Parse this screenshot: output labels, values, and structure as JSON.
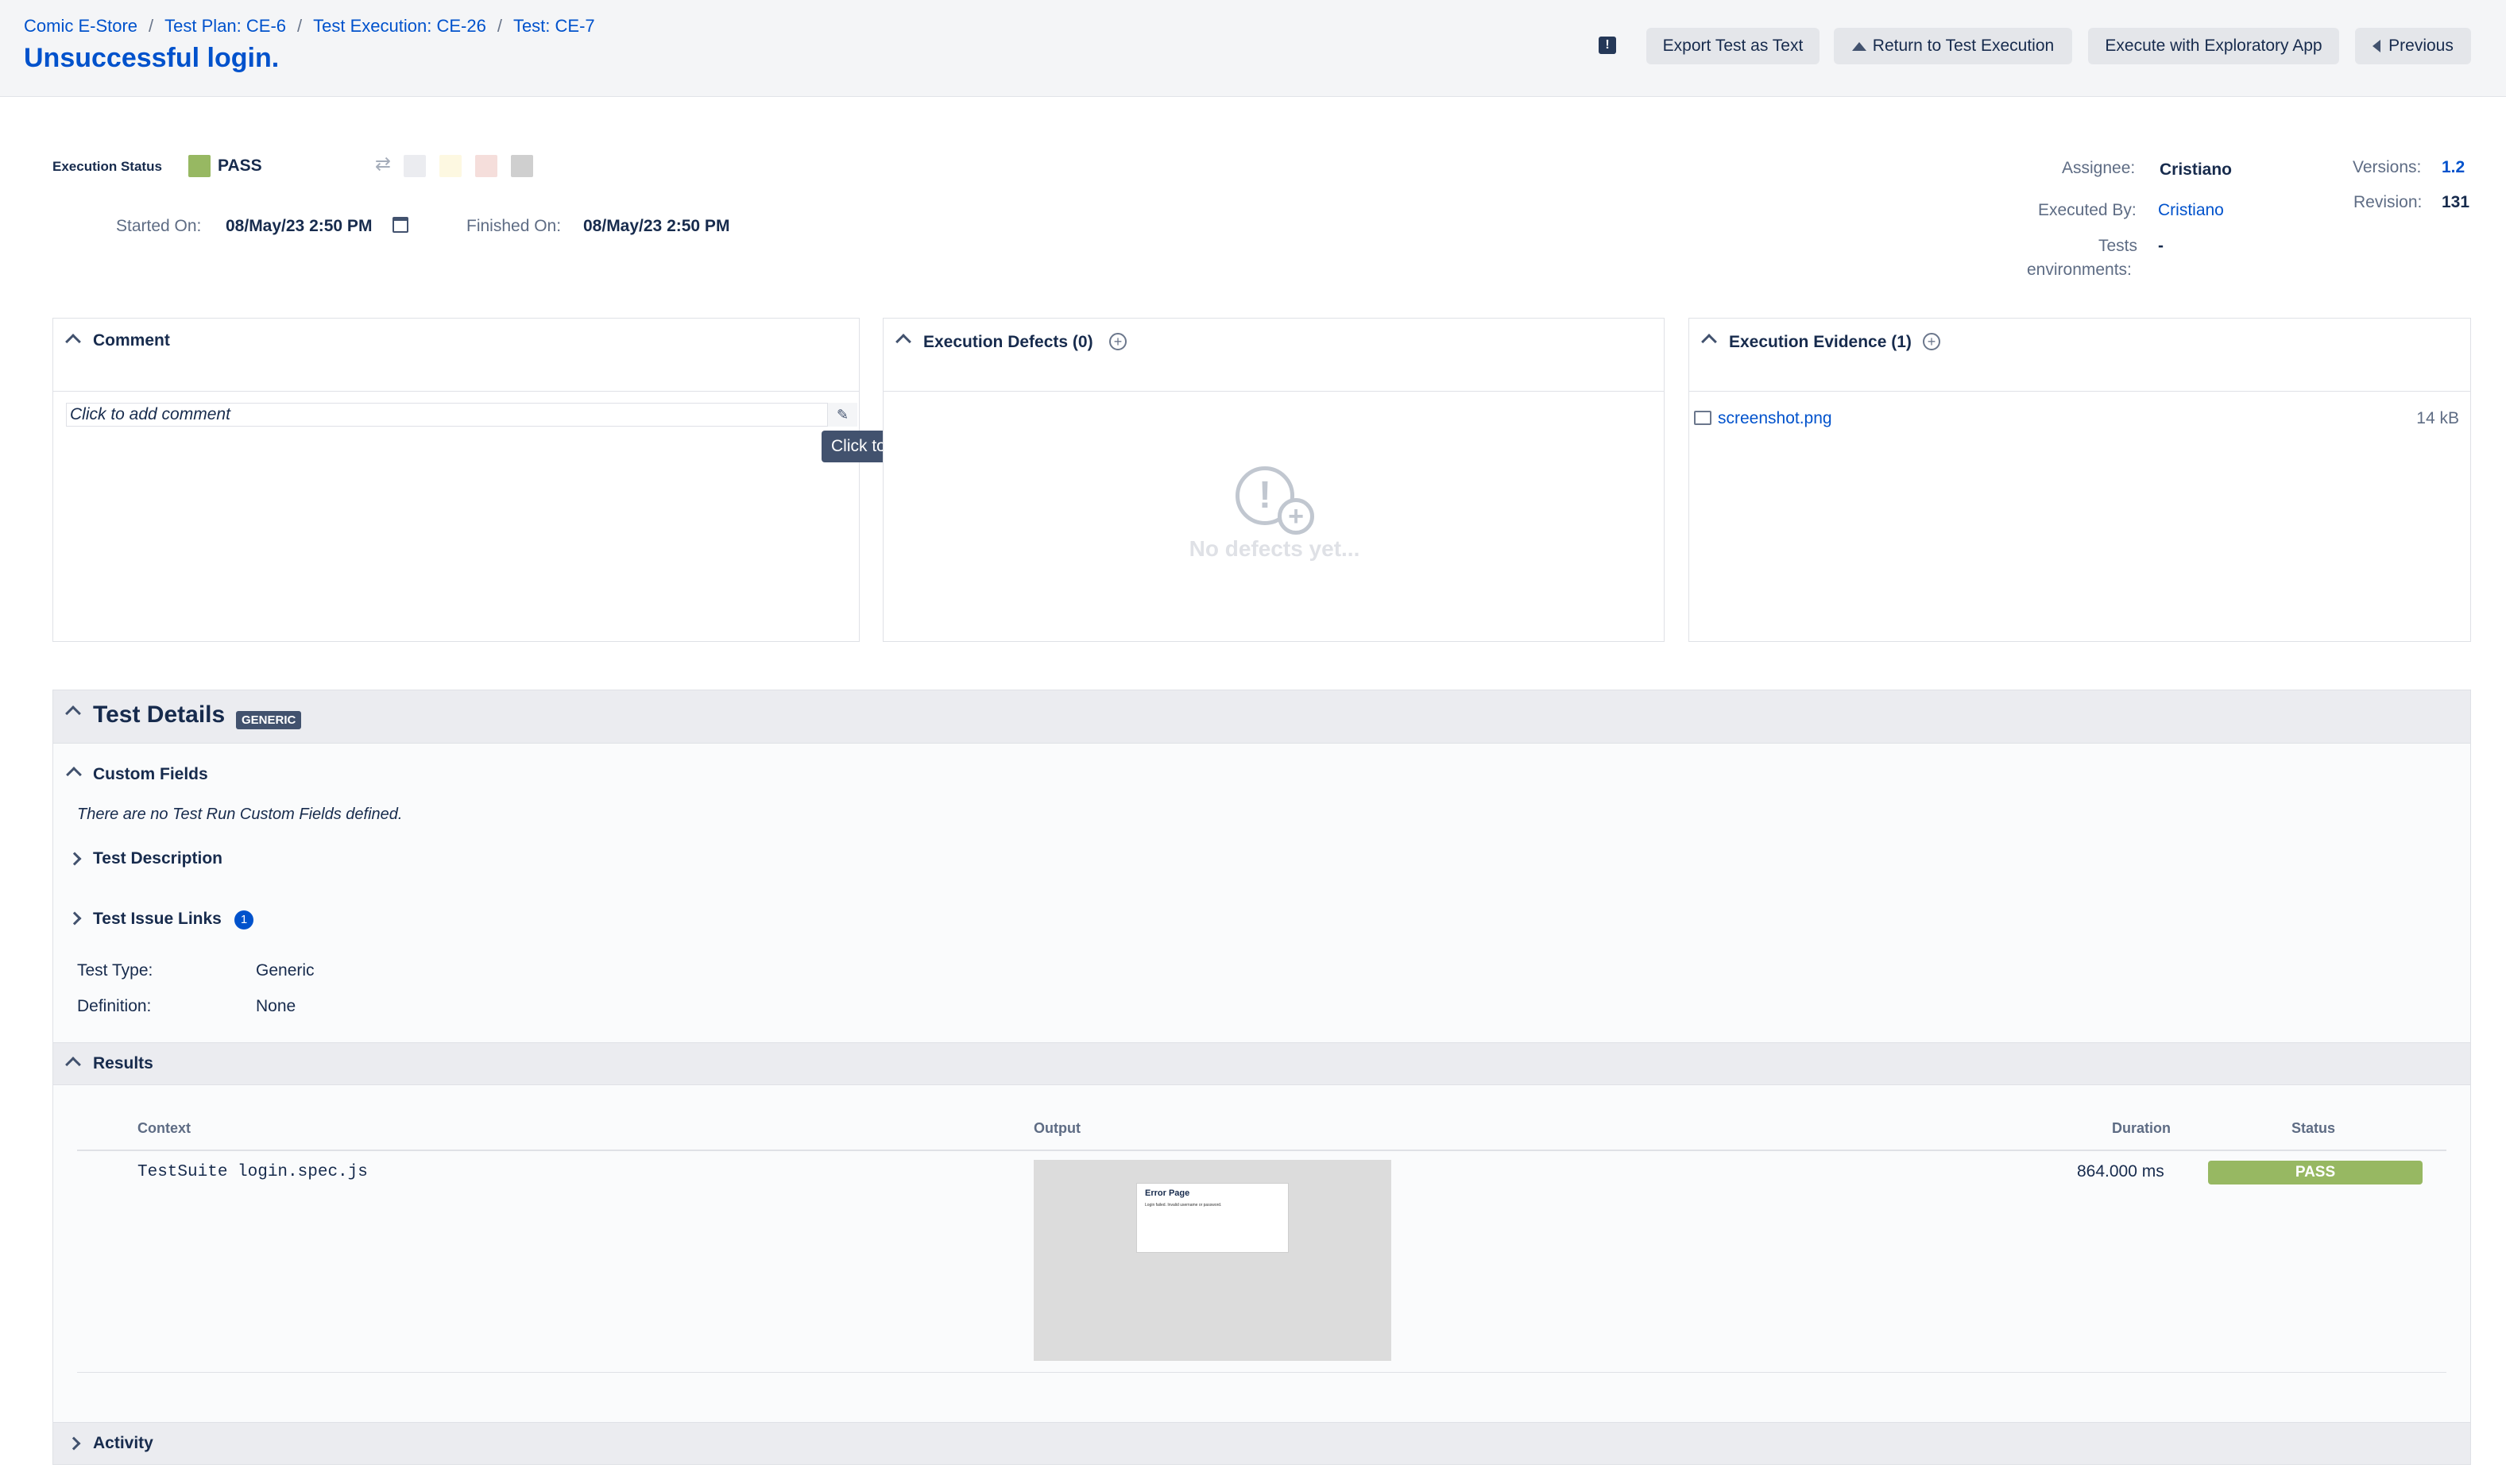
{
  "breadcrumb": {
    "project": "Comic E-Store",
    "test_plan": "Test Plan: CE-6",
    "test_execution": "Test Execution: CE-26",
    "test": "Test: CE-7"
  },
  "page_title": "Unsuccessful login.",
  "header_buttons": {
    "export": "Export Test as Text",
    "return": "Return to Test Execution",
    "exploratory": "Execute with Exploratory App",
    "previous": "Previous"
  },
  "status": {
    "label": "Execution Status",
    "value": "PASS",
    "pass_color": "#97b862",
    "swatches": [
      "#ebecf0",
      "#fdf8e1",
      "#f5dedb",
      "#cfcfcf"
    ]
  },
  "timing": {
    "started_label": "Started On:",
    "started_value": "08/May/23 2:50 PM",
    "finished_label": "Finished On:",
    "finished_value": "08/May/23 2:50 PM"
  },
  "meta": {
    "assignee_label": "Assignee:",
    "assignee_value": "Cristiano",
    "executed_label": "Executed By:",
    "executed_value": "Cristiano",
    "env_label_1": "Tests",
    "env_label_2": "environments:",
    "env_value": "-",
    "versions_label": "Versions:",
    "versions_value": "1.2",
    "revision_label": "Revision:",
    "revision_value": "131"
  },
  "comment": {
    "title": "Comment",
    "placeholder": "Click to add comment",
    "tooltip": "Click to edit"
  },
  "defects": {
    "title": "Execution Defects (0)",
    "empty": "No defects yet..."
  },
  "evidence": {
    "title": "Execution Evidence (1)",
    "file_name": "screenshot.png",
    "file_size": "14 kB"
  },
  "details": {
    "title": "Test Details",
    "badge": "GENERIC",
    "custom_fields_title": "Custom Fields",
    "custom_fields_empty": "There are no Test Run Custom Fields defined.",
    "description_title": "Test Description",
    "issue_links_title": "Test Issue Links",
    "issue_links_count": "1",
    "type_label": "Test Type:",
    "type_value": "Generic",
    "definition_label": "Definition:",
    "definition_value": "None"
  },
  "results": {
    "title": "Results",
    "columns": {
      "context": "Context",
      "output": "Output",
      "duration": "Duration",
      "status": "Status"
    },
    "row": {
      "context": "TestSuite login.spec.js",
      "thumb_title": "Error Page",
      "thumb_text": "Login failed. Invalid username or password.",
      "duration": "864.000 ms",
      "status": "PASS"
    }
  },
  "activity": {
    "title": "Activity"
  }
}
